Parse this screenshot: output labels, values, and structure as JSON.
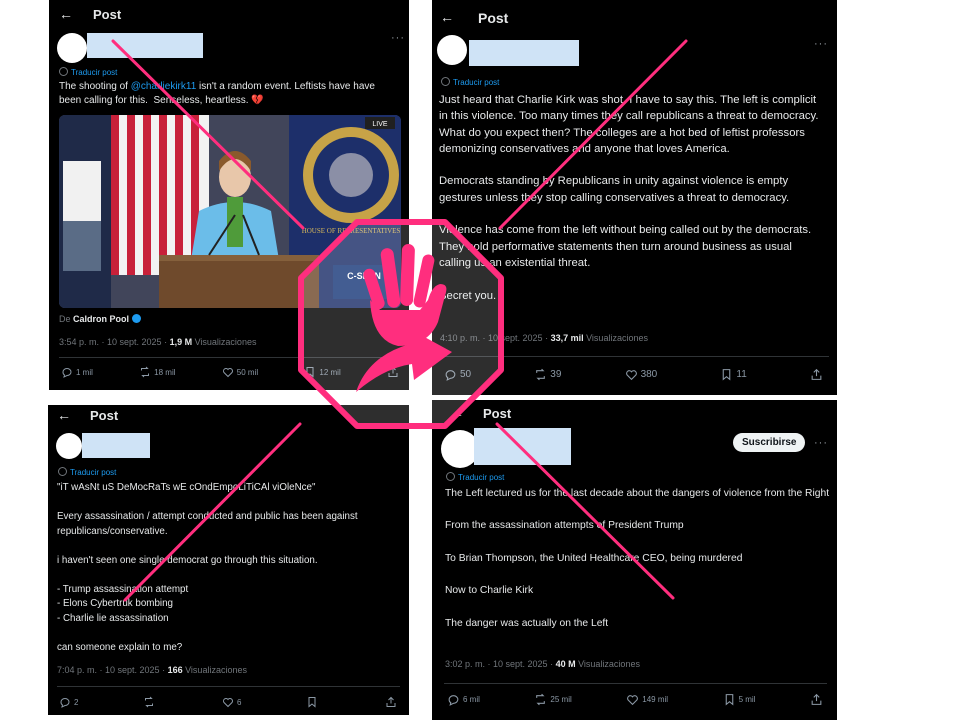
{
  "panel_tl": {
    "header_title": "Post",
    "translate": "Traducir post",
    "text_before": "The shooting of ",
    "mention": "@charliekirk11",
    "text_after": " isn't a random event. Leftists have have been calling for this.  Senseless, heartless. 💔",
    "image_credit_prefix": "De",
    "image_credit_name": "Caldron Pool",
    "image_caption_live": "LIVE",
    "image_caption_span": "C-SPAN",
    "image_caption_seal": "HOUSE OF REPRESENTATIVES",
    "timestamp": "3:54 p. m. · 10 sept. 2025 · ",
    "views_count": "1,9 M",
    "views_label": " Visualizaciones",
    "replies": "1 mil",
    "reposts": "18 mil",
    "likes": "50 mil",
    "bookmarks": "12 mil"
  },
  "panel_tr": {
    "header_title": "Post",
    "translate": "Traducir post",
    "text": "Just heard that Charlie Kirk was shot. I have to say this. The left is complicit in this violence. Too many times they call republicans a threat to democracy. What do you expect then? The colleges are a hot bed of leftist professors demonizing conservatives and anyone that loves America.\n\nDemocrats standing by Republicans in unity against violence is empty gestures unless they stop calling conservatives a threat to democracy.\n\nViolence has come from the left without being called out by the democrats. They hold performative statements then turn around business as usual calling us an existential threat.\n\nSecret you.",
    "timestamp": "4:10 p. m. · 10 sept. 2025 · ",
    "views_count": "33,7 mil",
    "views_label": " Visualizaciones",
    "replies": "50",
    "reposts": "39",
    "likes": "380",
    "bookmarks": "11"
  },
  "panel_bl": {
    "header_title": "Post",
    "translate": "Traducir post",
    "text": "\"iT wAsNt uS DeMocRaTs wE cOndEmpoLiTiCAl viOleNce\"\n\nEvery assassination / attempt conducted and public has been against republicans/conservative.\n\ni haven't seen one single democrat go through this situation.\n\n- Trump assassination attempt\n- Elons Cybertruk bombing\n- Charlie lie assassination\n\ncan someone explain to me?",
    "timestamp": "7:04 p. m. · 10 sept. 2025 · ",
    "views_count": "166",
    "views_label": " Visualizaciones",
    "replies": "2",
    "reposts": "",
    "likes": "6",
    "bookmarks": ""
  },
  "panel_br": {
    "header_title": "Post",
    "subscribe": "Suscribirse",
    "translate": "Traducir post",
    "text": "The Left lectured us for the last decade about the dangers of violence from the Right\n\nFrom the assassination attempts of President Trump\n\nTo Brian Thompson, the United Healthcare CEO, being murdered\n\nNow to Charlie Kirk\n\nThe danger was actually on the Left",
    "timestamp": "3:02 p. m. · 10 sept. 2025 · ",
    "views_count": "40 M",
    "views_label": " Visualizaciones",
    "replies": "6 mil",
    "reposts": "25 mil",
    "likes": "149 mil",
    "bookmarks": "5 mil"
  },
  "colors": {
    "accent_pink": "#ff2e7e",
    "link_blue": "#1d9bf0",
    "panel_bg": "#000000",
    "redaction": "#cfe3f6"
  },
  "icons": [
    "back-arrow-icon",
    "more-icon",
    "translate-globe-icon",
    "verified-badge-icon",
    "reply-icon",
    "repost-icon",
    "like-icon",
    "bookmark-icon",
    "share-icon",
    "stop-hand-icon",
    "curved-arrow-icon"
  ]
}
